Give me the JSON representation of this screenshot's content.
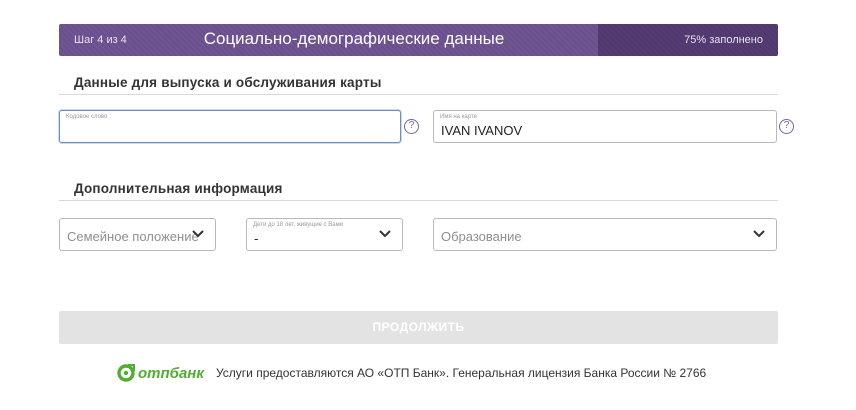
{
  "header": {
    "step": "Шаг 4 из 4",
    "title": "Социально-демографические данные",
    "percent_text": "75% заполнено",
    "progress": 0.75
  },
  "section_card": {
    "title": "Данные для выпуска и обслуживания карты"
  },
  "codeword": {
    "label": "Кодовое слово",
    "value": ""
  },
  "card_name": {
    "label": "Имя на карте",
    "value": "IVAN IVANOV"
  },
  "help_symbol": "?",
  "section_extra": {
    "title": "Дополнительная информация"
  },
  "marital": {
    "placeholder": "Семейное положение"
  },
  "children": {
    "label": "Дети до 18 лет, живущие с Вами",
    "value": "-"
  },
  "education": {
    "placeholder": "Образование"
  },
  "submit": {
    "label": "ПРОДОЛЖИТЬ"
  },
  "footer": {
    "logo_text": "отпбанк",
    "text": "Услуги предоставляются АО «ОТП Банк». Генеральная лицензия Банка России № 2766"
  },
  "colors": {
    "brand_purple": "#6a4f8d",
    "logo_green": "#52ae30",
    "focus_blue": "#6c8ec8"
  }
}
